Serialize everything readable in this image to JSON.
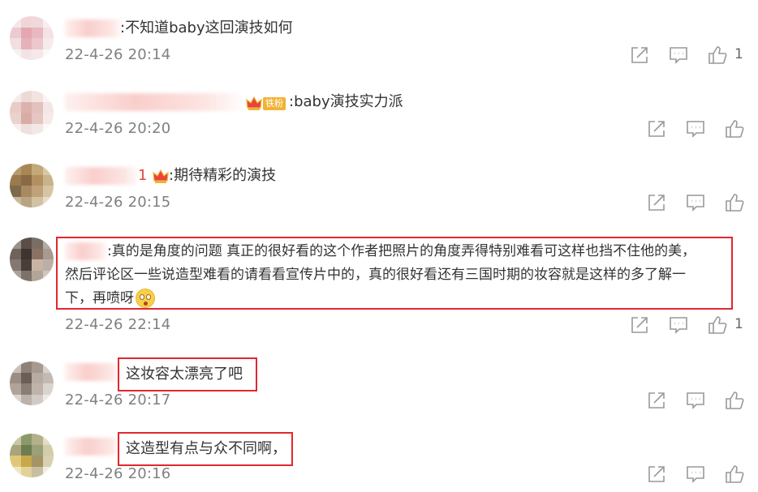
{
  "comments": [
    {
      "text": ":不知道baby这回演技如何",
      "time": "22-4-26 20:14",
      "likes": "1"
    },
    {
      "badge": "铁粉",
      "text": ":baby演技实力派",
      "time": "22-4-26 20:20",
      "likes": ""
    },
    {
      "name_suffix": "1",
      "text": ":期待精彩的演技",
      "time": "22-4-26 20:15",
      "likes": ""
    },
    {
      "line1": ":真的是角度的问题 真正的很好看的这个作者把照片的角度弄得特别难看可这样也挡不住他的美，",
      "line2": "然后评论区一些说造型难看的请看看宣传片中的，真的很好看还有三国时期的妆容就是这样的多了解一",
      "line3": "下，再喷呀",
      "time": "22-4-26 22:14",
      "likes": "1"
    },
    {
      "text": "这妆容太漂亮了吧",
      "time": "22-4-26 20:17",
      "likes": ""
    },
    {
      "text": "这造型有点与众不同啊，",
      "time": "22-4-26 20:16",
      "likes": ""
    }
  ],
  "icons": {
    "share": "share-icon",
    "comment": "comment-icon",
    "like": "like-icon",
    "emoji": "surprised-emoji-icon",
    "crown": "crown-icon"
  },
  "colors": {
    "highlight": "#e0282e",
    "time": "#808080",
    "icon": "#999999",
    "badge": "#f2b234"
  }
}
